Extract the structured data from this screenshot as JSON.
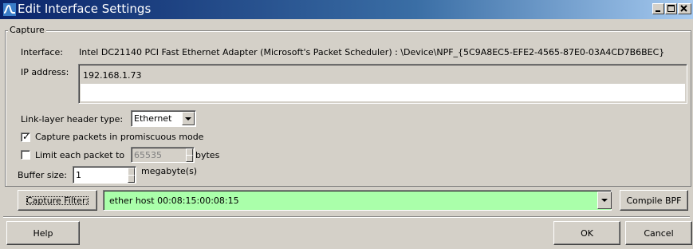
{
  "window": {
    "title": "Edit Interface Settings",
    "controls": [
      "minimize",
      "maximize",
      "close"
    ],
    "accent_color": "#0a246a"
  },
  "capture": {
    "group_label": "Capture",
    "interface_label": "Interface:",
    "interface_value": "Intel DC21140 PCI Fast Ethernet Adapter (Microsoft's Packet Scheduler) : \\Device\\NPF_{5C9A8EC5-EFE2-4565-87E0-03A4CD7B6BEC}",
    "ip_label": "IP address:",
    "ip_value": "192.168.1.73",
    "link_layer_label": "Link-layer header type:",
    "link_layer_value": "Ethernet",
    "promiscuous_label": "Capture packets in promiscuous mode",
    "promiscuous_checked": true,
    "limit_label": "Limit each packet to",
    "limit_value": "65535",
    "limit_unit": "bytes",
    "limit_checked": false,
    "buffer_label": "Buffer size:",
    "buffer_value": "1",
    "buffer_unit": "megabyte(s)"
  },
  "filter": {
    "button_label": "Capture Filter:",
    "value": "ether host 00:08:15:00:08:15",
    "compile_label": "Compile BPF",
    "field_color": "#aaffaa"
  },
  "footer": {
    "help_label": "Help",
    "ok_label": "OK",
    "cancel_label": "Cancel"
  }
}
